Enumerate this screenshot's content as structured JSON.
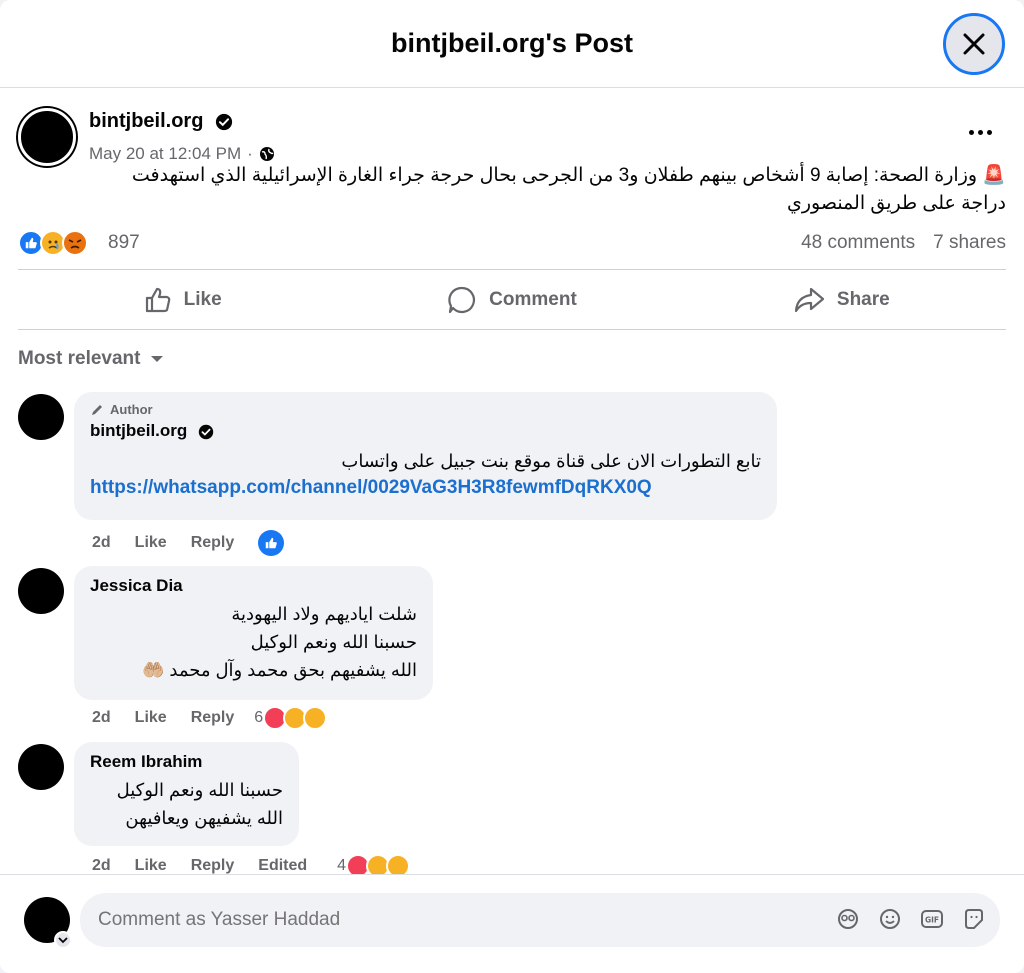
{
  "header": {
    "title": "bintjbeil.org's Post"
  },
  "post": {
    "author": "bintjbeil.org",
    "date": "May 20 at 12:04 PM",
    "meta_sep": "·",
    "text_line1": "🚨 وزارة الصحة: إصابة 9 أشخاص بينهم طفلان و3 من الجرحى بحال حرجة جراء الغارة الإسرائيلية الذي استهدفت",
    "text_line2": "دراجة على طريق المنصوري",
    "reaction_count": "897",
    "comments_count": "48 comments",
    "shares_count": "7 shares"
  },
  "actions": {
    "like": "Like",
    "comment": "Comment",
    "share": "Share"
  },
  "sort": {
    "label": "Most relevant"
  },
  "comments": [
    {
      "author_tag": "Author",
      "name": "bintjbeil.org",
      "line1": "تابع التطورات الان على قناة موقع بنت جبيل على واتساب",
      "link": "https://whatsapp.com/channel/0029VaG3H3R8fewmfDqRKX0Q",
      "time": "2d",
      "like": "Like",
      "reply": "Reply"
    },
    {
      "name": "Jessica Dia",
      "line1": "شلت اياديهم ولاد اليهودية",
      "line2": "حسبنا الله ونعم الوكيل",
      "line3": "الله يشفيهم بحق محمد وآل محمد 🤲🏼",
      "time": "2d",
      "like": "Like",
      "reply": "Reply",
      "react_count": "6"
    },
    {
      "name": "Reem Ibrahim",
      "line1": "حسبنا الله ونعم الوكيل",
      "line2": "الله يشفيهن ويعافيهن",
      "time": "2d",
      "like": "Like",
      "reply": "Reply",
      "edited": "Edited",
      "react_count": "4"
    }
  ],
  "composer": {
    "placeholder": "Comment as Yasser Haddad"
  },
  "colors": {
    "accent": "#1877f2",
    "link": "#1b6fce",
    "muted": "#65676b",
    "bubble": "#f0f2f5"
  }
}
